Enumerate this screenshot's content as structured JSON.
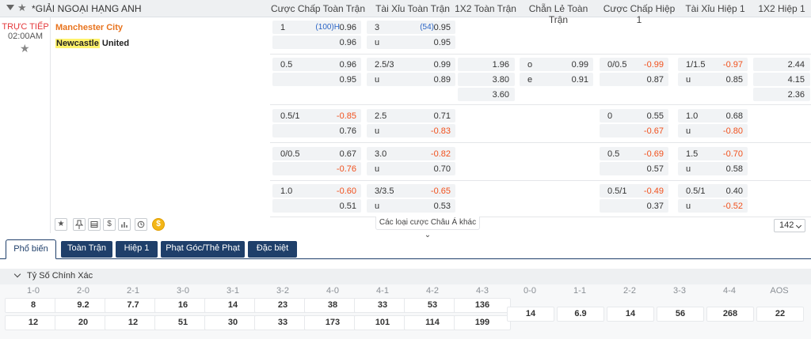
{
  "header": {
    "league": "*GIẢI NGOẠI HẠNG ANH",
    "columns": [
      "Cược Chấp Toàn Trận",
      "Tài Xỉu Toàn Trận",
      "1X2 Toàn Trận",
      "Chẵn Lẻ Toàn Trận",
      "Cược Chấp Hiệp 1",
      "Tài Xỉu Hiệp 1",
      "1X2 Hiệp 1"
    ]
  },
  "match": {
    "status": "TRỰC TIẾP",
    "time": "02:00AM",
    "home_team": "Manchester City",
    "away_highlight": "Newcastle",
    "away_rest": " United"
  },
  "odds": {
    "r1": {
      "ah_line": "1",
      "ah_sub": "(100)H",
      "ah_home": "0.96",
      "ah_away": "0.96",
      "ou_line": "3",
      "ou_sub": "(54)",
      "ou_over": "0.95",
      "ou_under_lbl": "u",
      "ou_under": "0.95"
    },
    "r2": {
      "ah_line": "0.5",
      "ah_home": "0.96",
      "ah_away": "0.95",
      "ou_line": "2.5/3",
      "ou_over": "0.99",
      "ou_under_lbl": "u",
      "ou_under": "0.89",
      "x12_1": "1.96",
      "x12_2": "3.80",
      "x12_3": "3.60",
      "oe_o_lbl": "o",
      "oe_o": "0.99",
      "oe_e_lbl": "e",
      "oe_e": "0.91",
      "h1ah_line": "0/0.5",
      "h1ah_home": "-0.99",
      "h1ah_away": "0.87",
      "h1ou_line": "1/1.5",
      "h1ou_over": "-0.97",
      "h1ou_under_lbl": "u",
      "h1ou_under": "0.85",
      "h1x_1": "2.44",
      "h1x_2": "4.15",
      "h1x_3": "2.36"
    },
    "r3": {
      "ah_line": "0.5/1",
      "ah_home": "-0.85",
      "ah_away": "0.76",
      "ou_line": "2.5",
      "ou_over": "0.71",
      "ou_under_lbl": "u",
      "ou_under": "-0.83",
      "h1ah_line": "0",
      "h1ah_home": "0.55",
      "h1ah_away": "-0.67",
      "h1ou_line": "1.0",
      "h1ou_over": "0.68",
      "h1ou_under_lbl": "u",
      "h1ou_under": "-0.80"
    },
    "r4": {
      "ah_line": "0/0.5",
      "ah_home": "0.67",
      "ah_away": "-0.76",
      "ou_line": "3.0",
      "ou_over": "-0.82",
      "ou_under_lbl": "u",
      "ou_under": "0.70",
      "h1ah_line": "0.5",
      "h1ah_home": "-0.69",
      "h1ah_away": "0.57",
      "h1ou_line": "1.5",
      "h1ou_over": "-0.70",
      "h1ou_under_lbl": "u",
      "h1ou_under": "0.58"
    },
    "r5": {
      "ah_line": "1.0",
      "ah_home": "-0.60",
      "ah_away": "0.51",
      "ou_line": "3/3.5",
      "ou_over": "-0.65",
      "ou_under_lbl": "u",
      "ou_under": "0.53",
      "h1ah_line": "0.5/1",
      "h1ah_home": "-0.49",
      "h1ah_away": "0.37",
      "h1ou_line": "0.5/1",
      "h1ou_over": "0.40",
      "h1ou_under_lbl": "u",
      "h1ou_under": "-0.52"
    }
  },
  "tools": {
    "star": "★",
    "dollar": "$",
    "coin": "$"
  },
  "more_link": "Các loại cược Châu Á khác",
  "market_count": "142",
  "tabs": [
    "Phổ biến",
    "Toàn Trận",
    "Hiệp 1",
    "Phạt Góc/Thẻ Phạt",
    "Đặc biệt"
  ],
  "correct_score": {
    "title": "Tỷ Số Chính Xác",
    "headers": [
      "1-0",
      "2-0",
      "2-1",
      "3-0",
      "3-1",
      "3-2",
      "4-0",
      "4-1",
      "4-2",
      "4-3",
      "0-0",
      "1-1",
      "2-2",
      "3-3",
      "4-4",
      "AOS"
    ],
    "home_row": [
      "8",
      "9.2",
      "7.7",
      "16",
      "14",
      "23",
      "38",
      "33",
      "53",
      "136"
    ],
    "away_row": [
      "12",
      "20",
      "12",
      "51",
      "30",
      "33",
      "173",
      "101",
      "114",
      "199"
    ],
    "draw_row": [
      "14",
      "6.9",
      "14",
      "56",
      "268",
      "22"
    ]
  },
  "colors": {
    "negative": "#f1501c",
    "live": "#e4393c",
    "home_team": "#e8731d",
    "tab_dark": "#1f3f6a"
  }
}
